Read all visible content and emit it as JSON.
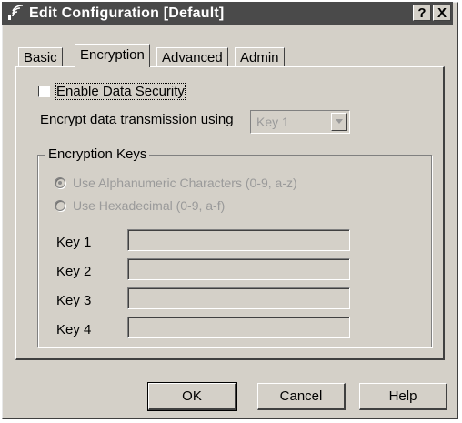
{
  "window": {
    "title": "Edit Configuration [Default]",
    "help_button": "?",
    "close_button": "X"
  },
  "tabs": [
    {
      "label": "Basic"
    },
    {
      "label": "Encryption",
      "active": true
    },
    {
      "label": "Advanced"
    },
    {
      "label": "Admin"
    }
  ],
  "encryption": {
    "enable_data_security": {
      "label": "Enable Data Security",
      "checked": false
    },
    "encrypt_label": "Encrypt data transmission using",
    "encrypt_select": {
      "value": "Key 1",
      "disabled": true
    },
    "keys_group": {
      "title": "Encryption Keys",
      "radio_alphanumeric": {
        "label": "Use Alphanumeric Characters (0-9, a-z)",
        "selected": true,
        "disabled": true
      },
      "radio_hex": {
        "label": "Use Hexadecimal (0-9, a-f)",
        "selected": false,
        "disabled": true
      },
      "keys": [
        {
          "label": "Key 1",
          "value": ""
        },
        {
          "label": "Key 2",
          "value": ""
        },
        {
          "label": "Key 3",
          "value": ""
        },
        {
          "label": "Key 4",
          "value": ""
        }
      ]
    }
  },
  "buttons": {
    "ok": "OK",
    "cancel": "Cancel",
    "help": "Help"
  },
  "colors": {
    "dialog_face": "#d4d0c8",
    "titlebar": "#4a4a4a",
    "disabled_text": "#9a9a9a"
  }
}
